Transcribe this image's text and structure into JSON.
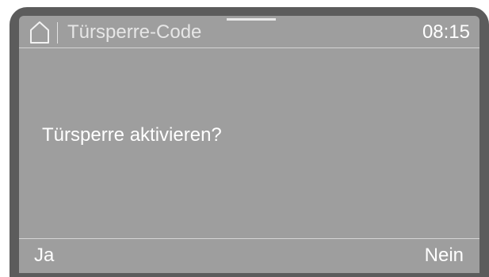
{
  "header": {
    "home_icon": "home-icon",
    "title": "Türsperre-Code",
    "time": "08:15"
  },
  "main": {
    "prompt": "Türsperre aktivieren?"
  },
  "footer": {
    "left_label": "Ja",
    "right_label": "Nein"
  },
  "colors": {
    "screen_background": "#9e9e9e",
    "bezel": "#5c5c5c",
    "text": "#ffffff"
  }
}
